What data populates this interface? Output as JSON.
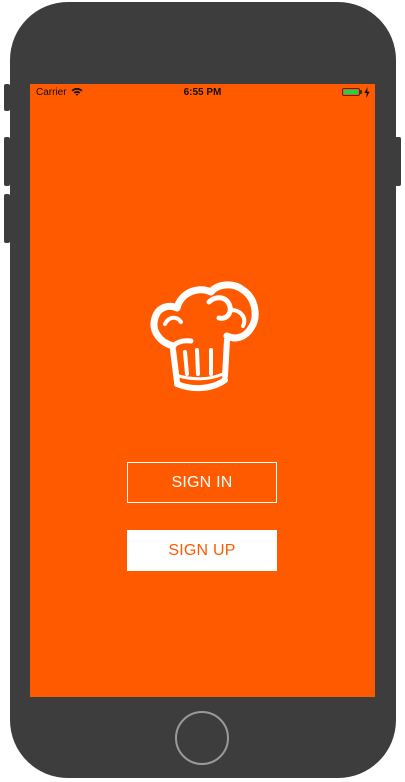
{
  "colors": {
    "accent": "#FF5A00",
    "device_frame": "#3D3D3D",
    "battery_fill": "#2ECC40",
    "button_text_light": "#FFFFFF"
  },
  "status_bar": {
    "carrier": "Carrier",
    "time": "6:55 PM",
    "wifi_icon": "wifi-icon",
    "battery_icon": "battery-icon",
    "battery_level": 1.0,
    "charging_icon": "charging-bolt-icon"
  },
  "logo": {
    "icon": "chef-hat-icon"
  },
  "auth": {
    "sign_in_label": "SIGN IN",
    "sign_up_label": "SIGN UP"
  }
}
